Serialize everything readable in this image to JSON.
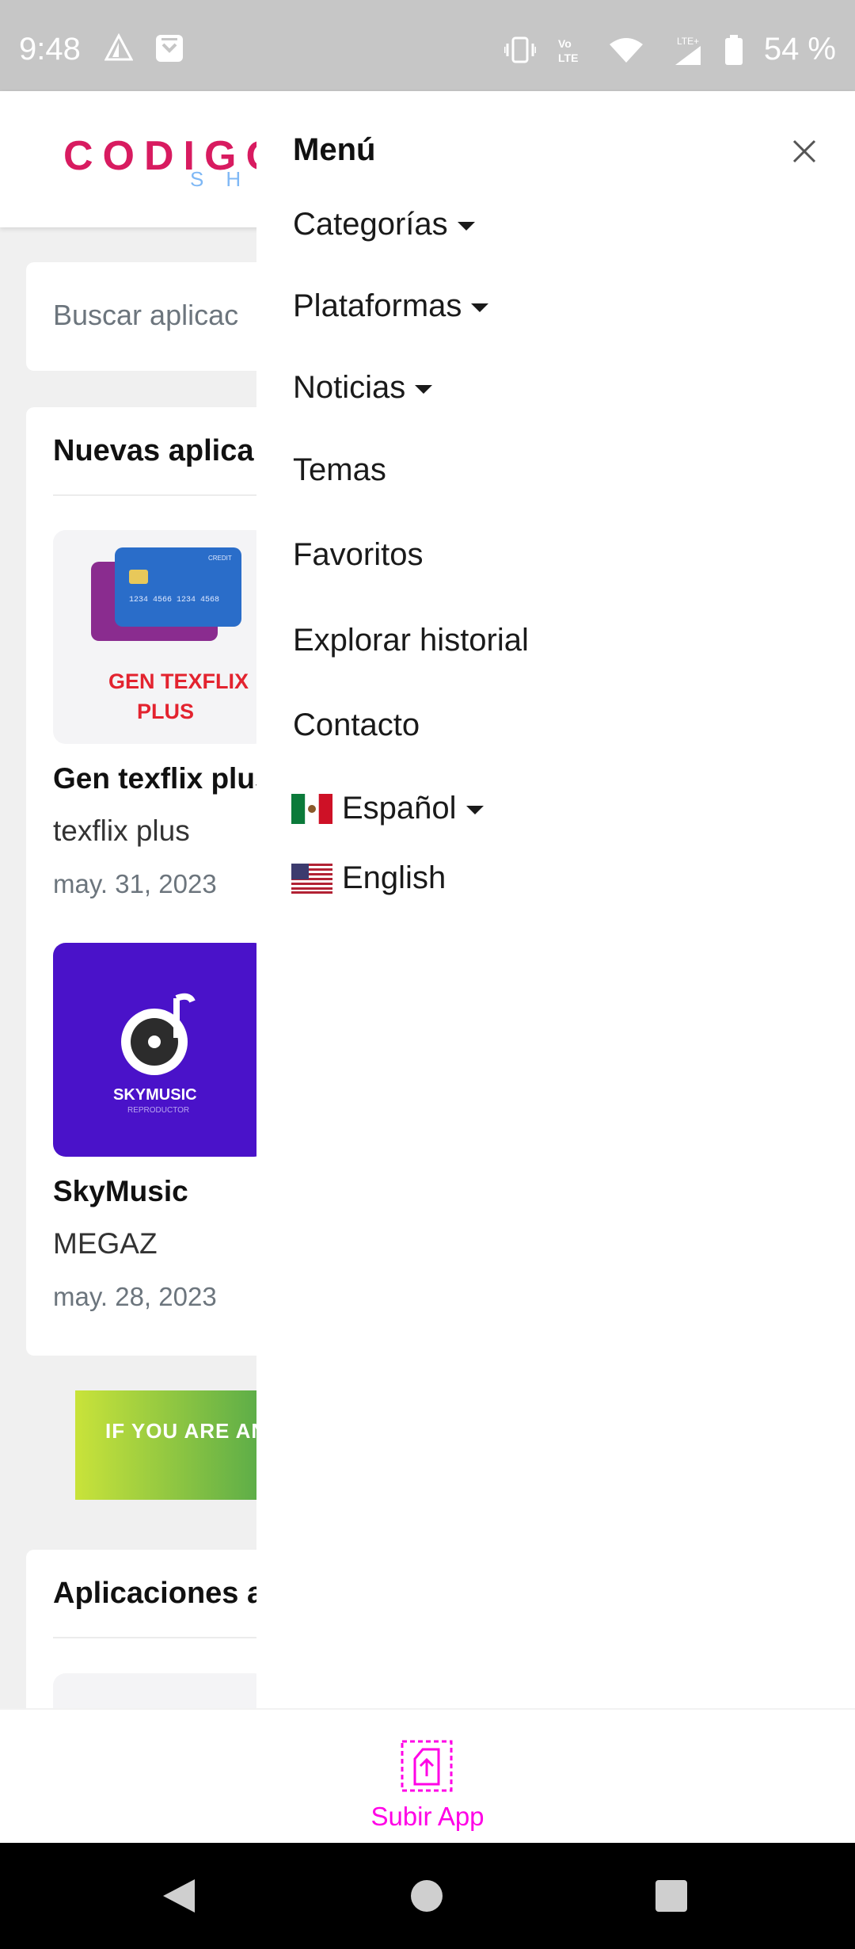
{
  "status_bar": {
    "time": "9:48",
    "battery": "54 %",
    "icons": [
      "alert-triangle-icon",
      "shopping-bag-icon",
      "vibrate-icon",
      "volte-icon",
      "wifi-icon",
      "lte-signal-icon",
      "battery-icon"
    ]
  },
  "header": {
    "logo_main": "CODIGO",
    "logo_sub": "SHO"
  },
  "search": {
    "placeholder": "Buscar aplicac"
  },
  "new_apps": {
    "title": "Nuevas aplica",
    "items": [
      {
        "name": "Gen texflix plus",
        "developer": "texflix plus",
        "date": "may. 31, 2023",
        "thumb_text_1": "GEN TEXFLIX",
        "thumb_text_2": "PLUS"
      },
      {
        "name": "SkyMusic",
        "developer": "MEGAZ",
        "date": "may. 28, 2023",
        "thumb_text_1": "SKYMUSIC",
        "thumb_text_2": "REPRODUCTOR"
      }
    ]
  },
  "ad": {
    "text": "IF YOU ARE AN A"
  },
  "popular": {
    "title": "Aplicaciones a"
  },
  "drawer": {
    "title": "Menú",
    "items": [
      {
        "label": "Categorías",
        "has_caret": true
      },
      {
        "label": "Plataformas",
        "has_caret": true
      },
      {
        "label": "Noticias",
        "has_caret": true
      },
      {
        "label": "Temas",
        "has_caret": false
      },
      {
        "label": "Favoritos",
        "has_caret": false
      },
      {
        "label": "Explorar historial",
        "has_caret": false
      },
      {
        "label": "Contacto",
        "has_caret": false
      }
    ],
    "languages": [
      {
        "label": "Español",
        "flag": "mexico-flag-icon",
        "has_caret": true
      },
      {
        "label": "English",
        "flag": "usa-flag-icon",
        "has_caret": false
      }
    ]
  },
  "bottom_bar": {
    "upload_label": "Subir App",
    "accent_color": "#ff00e6"
  },
  "colors": {
    "logo": "#d81b60",
    "logo_sub": "#7fb8f5",
    "status_bar": "#c6c6c6",
    "skymusic_bg": "#4a12c9"
  }
}
